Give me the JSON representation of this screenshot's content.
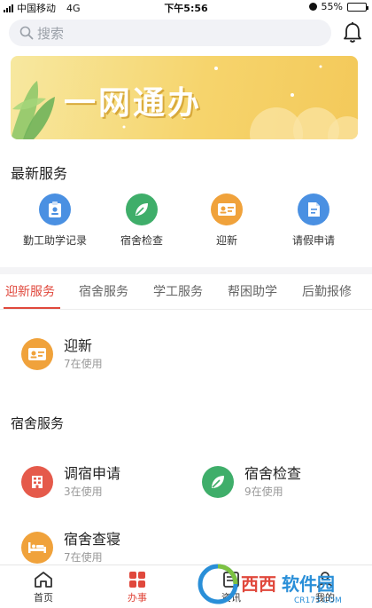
{
  "status_bar": {
    "carrier": "中国移动",
    "network": "4G",
    "time": "下午5:56",
    "battery": "55%",
    "battery_level": 0.55
  },
  "search": {
    "placeholder": "搜索"
  },
  "banner": {
    "title": "一网通办"
  },
  "latest_services": {
    "title": "最新服务",
    "items": [
      {
        "label": "勤工助学记录",
        "icon": "badge-icon",
        "color": "#4a90e2"
      },
      {
        "label": "宿舍检查",
        "icon": "leaf-icon",
        "color": "#3fae6a"
      },
      {
        "label": "迎新",
        "icon": "id-card-icon",
        "color": "#f0a23b"
      },
      {
        "label": "请假申请",
        "icon": "document-icon",
        "color": "#4a90e2"
      }
    ]
  },
  "tabs": [
    "迎新服务",
    "宿舍服务",
    "学工服务",
    "帮困助学",
    "后勤报修"
  ],
  "welcome_entry": {
    "name": "迎新",
    "count": "7在使用"
  },
  "dorm_services": {
    "title": "宿舍服务",
    "items": [
      {
        "name": "调宿申请",
        "count": "3在使用",
        "icon": "building-icon",
        "color": "#e55a4b"
      },
      {
        "name": "宿舍检查",
        "count": "9在使用",
        "icon": "leaf-icon",
        "color": "#3fae6a"
      },
      {
        "name": "宿舍查寝",
        "count": "7在使用",
        "icon": "bed-icon",
        "color": "#f0a23b"
      }
    ]
  },
  "bottom_nav": [
    "首页",
    "办事",
    "资讯",
    "我的"
  ],
  "watermark": {
    "brand": "西西软件园",
    "site": "CR173.COM"
  },
  "colors": {
    "accent": "#e0483c",
    "banner": "#f6d46c"
  }
}
